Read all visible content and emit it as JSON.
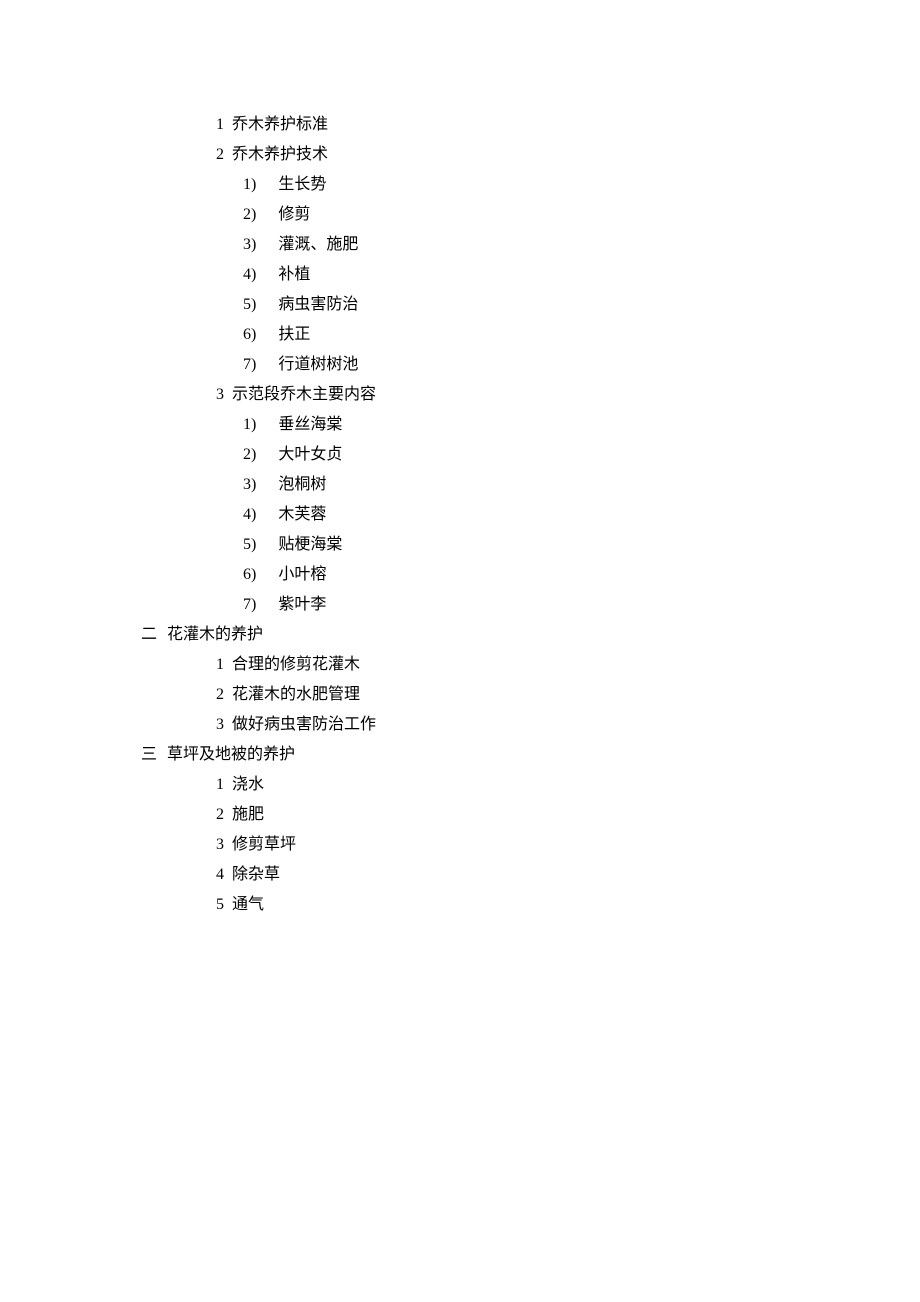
{
  "section1": {
    "items": [
      {
        "num": "1",
        "text": "乔木养护标准"
      },
      {
        "num": "2",
        "text": "乔木养护技术",
        "children": [
          {
            "num": "1)",
            "text": "生长势"
          },
          {
            "num": "2)",
            "text": "修剪"
          },
          {
            "num": "3)",
            "text": "灌溉、施肥"
          },
          {
            "num": "4)",
            "text": "补植"
          },
          {
            "num": "5)",
            "text": "病虫害防治"
          },
          {
            "num": "6)",
            "text": "扶正"
          },
          {
            "num": "7)",
            "text": "行道树树池"
          }
        ]
      },
      {
        "num": "3",
        "text": "示范段乔木主要内容",
        "children": [
          {
            "num": "1)",
            "text": "垂丝海棠"
          },
          {
            "num": "2)",
            "text": "大叶女贞"
          },
          {
            "num": "3)",
            "text": "泡桐树"
          },
          {
            "num": "4)",
            "text": "木芙蓉"
          },
          {
            "num": "5)",
            "text": "贴梗海棠"
          },
          {
            "num": "6)",
            "text": "小叶榕"
          },
          {
            "num": "7)",
            "text": "紫叶李"
          }
        ]
      }
    ]
  },
  "section2": {
    "num": "二",
    "text": "花灌木的养护",
    "items": [
      {
        "num": "1",
        "text": "合理的修剪花灌木"
      },
      {
        "num": "2",
        "text": "花灌木的水肥管理"
      },
      {
        "num": "3",
        "text": "做好病虫害防治工作"
      }
    ]
  },
  "section3": {
    "num": "三",
    "text": "草坪及地被的养护",
    "items": [
      {
        "num": "1",
        "text": "浇水"
      },
      {
        "num": "2",
        "text": "施肥"
      },
      {
        "num": "3",
        "text": "修剪草坪"
      },
      {
        "num": "4",
        "text": "除杂草"
      },
      {
        "num": "5",
        "text": "通气"
      }
    ]
  }
}
